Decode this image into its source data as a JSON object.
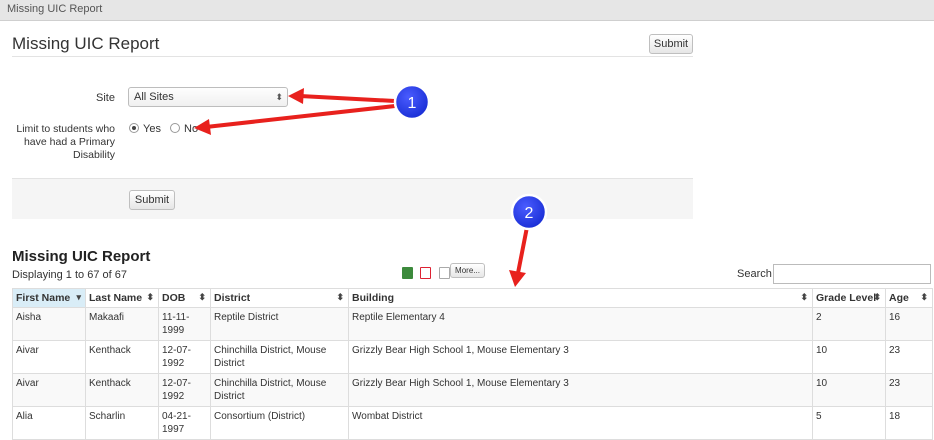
{
  "tab": {
    "label": "Missing UIC Report"
  },
  "form": {
    "title": "Missing UIC Report",
    "submit_top": "Submit",
    "site_label": "Site",
    "site_value": "All Sites",
    "limit_label_line1": "Limit to students who",
    "limit_label_line2": "have had a Primary",
    "limit_label_line3": "Disability",
    "option_yes": "Yes",
    "option_no": "No",
    "selected_option": "Yes",
    "submit_bottom": "Submit"
  },
  "report": {
    "title": "Missing UIC Report",
    "displaying": "Displaying 1 to 67 of 67",
    "more_label": "More...",
    "search_label": "Search",
    "search_value": "",
    "columns": [
      "First Name",
      "Last Name",
      "DOB",
      "District",
      "Building",
      "Grade Level",
      "Age"
    ],
    "rows": [
      [
        "Aisha",
        "Makaafi",
        "11-11-1999",
        "Reptile District",
        "Reptile Elementary 4",
        "2",
        "16"
      ],
      [
        "Aivar",
        "Kenthack",
        "12-07-1992",
        "Chinchilla District, Mouse District",
        "Grizzly Bear High School 1, Mouse Elementary 3",
        "10",
        "23"
      ],
      [
        "Aivar",
        "Kenthack",
        "12-07-1992",
        "Chinchilla District, Mouse District",
        "Grizzly Bear High School 1, Mouse Elementary 3",
        "10",
        "23"
      ],
      [
        "Alia",
        "Scharlin",
        "04-21-1997",
        "Consortium (District)",
        "Wombat District",
        "5",
        "18"
      ]
    ]
  },
  "callouts": [
    "1",
    "2"
  ],
  "colors": {
    "arrow": "#e8211d",
    "callout": "#1a2fd6",
    "sorted_header": "#d9edf7"
  }
}
